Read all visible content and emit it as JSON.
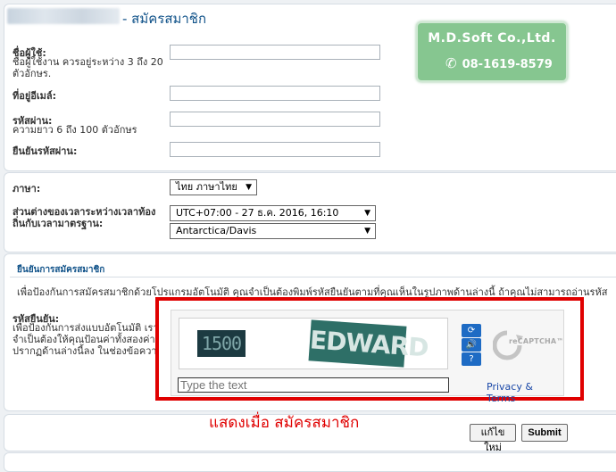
{
  "header": {
    "title": "- สมัครสมาชิก"
  },
  "logo": {
    "company": "M.D.Soft Co.,Ltd.",
    "phone": "08-1619-8579",
    "icon": "phone-icon"
  },
  "form": {
    "username_label": "ชื่อผู้ใช้:",
    "username_hint": "ชื่อผู้ใช้งาน ควรอยู่ระหว่าง 3 ถึง 20 ตัวอักษร.",
    "email_label": "ที่อยู่อีเมล์:",
    "password_label": "รหัสผ่าน:",
    "password_hint": "ความยาว 6 ถึง 100 ตัวอักษร",
    "confirm_label": "ยืนยันรหัสผ่าน:",
    "language_label": "ภาษา:",
    "language_value": "ไทย ภาษาไทย",
    "timezone_label": "ส่วนต่างของเวลาระหว่างเวลาท้องถิ่นกับเวลามาตรฐาน:",
    "timezone_value": "UTC+07:00 - 27 ธ.ค. 2016, 16:10",
    "timezone_region": "Antarctica/Davis"
  },
  "captcha_section": {
    "title": "ยืนยันการสมัครสมาชิก",
    "description": "เพื่อป้องกันการสมัครสมาชิกด้วยโปรแกรมอัตโนมัติ คุณจำเป็นต้องพิมพ์รหัสยืนยันตามที่คุณเห็นในรูปภาพด้านล่างนี้ ถ้าคุณไม่สามารถอ่านรหัส",
    "label": "รหัสยืนยัน:",
    "hint_line1": "เพื่อป้องกันการส่งแบบอัตโนมัติ เรา",
    "hint_line2": "จำเป็นต้องให้คุณป้อนค่าทั้งสองค่าที่",
    "hint_line3": "ปรากฏด้านล่างนี้ลง ในช่องข้อความ",
    "word1": "1500",
    "word2": "EDWARD",
    "input_placeholder": "Type the text",
    "privacy": "Privacy & Terms",
    "brand": "reCAPTCHA™"
  },
  "annotation": {
    "text": "แสดงเมื่อ สมัครสมาชิก",
    "color": "#e00000"
  },
  "buttons": {
    "reset": "แก้ไขใหม่",
    "submit": "Submit"
  }
}
